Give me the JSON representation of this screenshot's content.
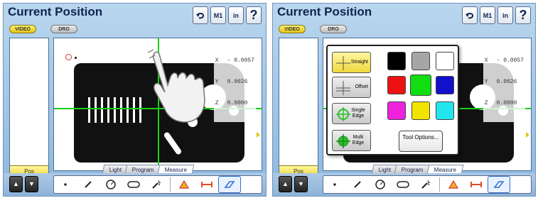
{
  "screens": [
    {
      "title": "Current Position",
      "mode_buttons": [
        "VIDEO",
        "DRO"
      ],
      "top_buttons": [
        "M1",
        "in",
        "?"
      ],
      "pos_label": "Pos",
      "dro": [
        [
          "X",
          "- 0.0057"
        ],
        [
          "Y",
          "0.0026"
        ],
        [
          "Z",
          "0.0000"
        ]
      ],
      "tabs": [
        "Light",
        "Program",
        "Measure"
      ]
    },
    {
      "title": "Current Position",
      "mode_buttons": [
        "VIDEO",
        "DRO"
      ],
      "top_buttons": [
        "M1",
        "in",
        "?"
      ],
      "pos_label": "Pos",
      "dro": [
        [
          "X",
          "- 0.0057"
        ],
        [
          "Y",
          "0.0026"
        ],
        [
          "Z",
          "0.0000"
        ]
      ],
      "tabs": [
        "Light",
        "Program",
        "Measure"
      ],
      "popup": {
        "buttons": [
          "Straight",
          "Offset",
          "Single Edge",
          "Multi Edge"
        ],
        "colors": [
          "#000000",
          "#a6a6a6",
          "#ffffff",
          "#ee1111",
          "#11dd11",
          "#1111cc",
          "#ee22dd",
          "#f2e400",
          "#22e6ee"
        ],
        "tool_options": "Tool Options..."
      }
    }
  ],
  "icons": {
    "back": "undo-arrow-icon",
    "up": "up-arrow-icon",
    "down": "down-arrow-icon",
    "tools": [
      "point-tool-icon",
      "line-tool-icon",
      "circle-tool-icon",
      "slot-tool-icon",
      "auto-measure-icon",
      "angle-tool-icon",
      "distance-tool-icon",
      "probe-tool-icon"
    ]
  }
}
